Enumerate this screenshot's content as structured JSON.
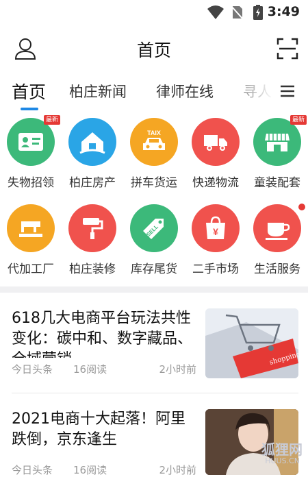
{
  "status_bar": {
    "time": "3:49",
    "icons": [
      "wifi-icon",
      "no-sim-icon",
      "battery-charging-icon"
    ]
  },
  "app_bar": {
    "title": "首页",
    "left_icon": "user-icon",
    "right_icon": "scan-icon"
  },
  "tabs": [
    {
      "label": "首页",
      "active": true
    },
    {
      "label": "柏庄新闻",
      "active": false
    },
    {
      "label": "律师在线",
      "active": false
    },
    {
      "label": "寻人",
      "active": false
    }
  ],
  "tab_menu_icon": "menu-icon",
  "categories": [
    {
      "label": "失物招领",
      "icon": "id-card-icon",
      "color": "#3cb97a",
      "badge": "最新"
    },
    {
      "label": "柏庄房产",
      "icon": "house-icon",
      "color": "#2aa5e6"
    },
    {
      "label": "拼车货运",
      "icon": "taxi-icon",
      "color": "#f5a623",
      "icon_text": "TAIX"
    },
    {
      "label": "快递物流",
      "icon": "truck-icon",
      "color": "#f0524d"
    },
    {
      "label": "童装配套",
      "icon": "store-icon",
      "color": "#3cb97a",
      "badge": "最新"
    },
    {
      "label": "代加工厂",
      "icon": "sewing-machine-icon",
      "color": "#f5a623"
    },
    {
      "label": "柏庄装修",
      "icon": "paint-roller-icon",
      "color": "#f0524d"
    },
    {
      "label": "库存尾货",
      "icon": "sell-tag-icon",
      "color": "#3cb97a",
      "icon_text": "SELL"
    },
    {
      "label": "二手市场",
      "icon": "shopping-bag-icon",
      "color": "#f0524d",
      "icon_text": "¥"
    },
    {
      "label": "生活服务",
      "icon": "coffee-cup-icon",
      "color": "#f0524d",
      "dot": true
    }
  ],
  "news": [
    {
      "title": "618几大电商平台玩法共性变化：碳中和、数字藏品、全域营销",
      "source": "今日头条",
      "reads": "16阅读",
      "time": "2小时前",
      "thumb_text": "shopping"
    },
    {
      "title": "2021电商十大起落！阿里跌倒，京东逢生",
      "source": "今日头条",
      "reads": "16阅读",
      "time": "2小时前"
    }
  ],
  "watermark": {
    "text": "狐狸网",
    "sub": "HUUS.CN"
  }
}
